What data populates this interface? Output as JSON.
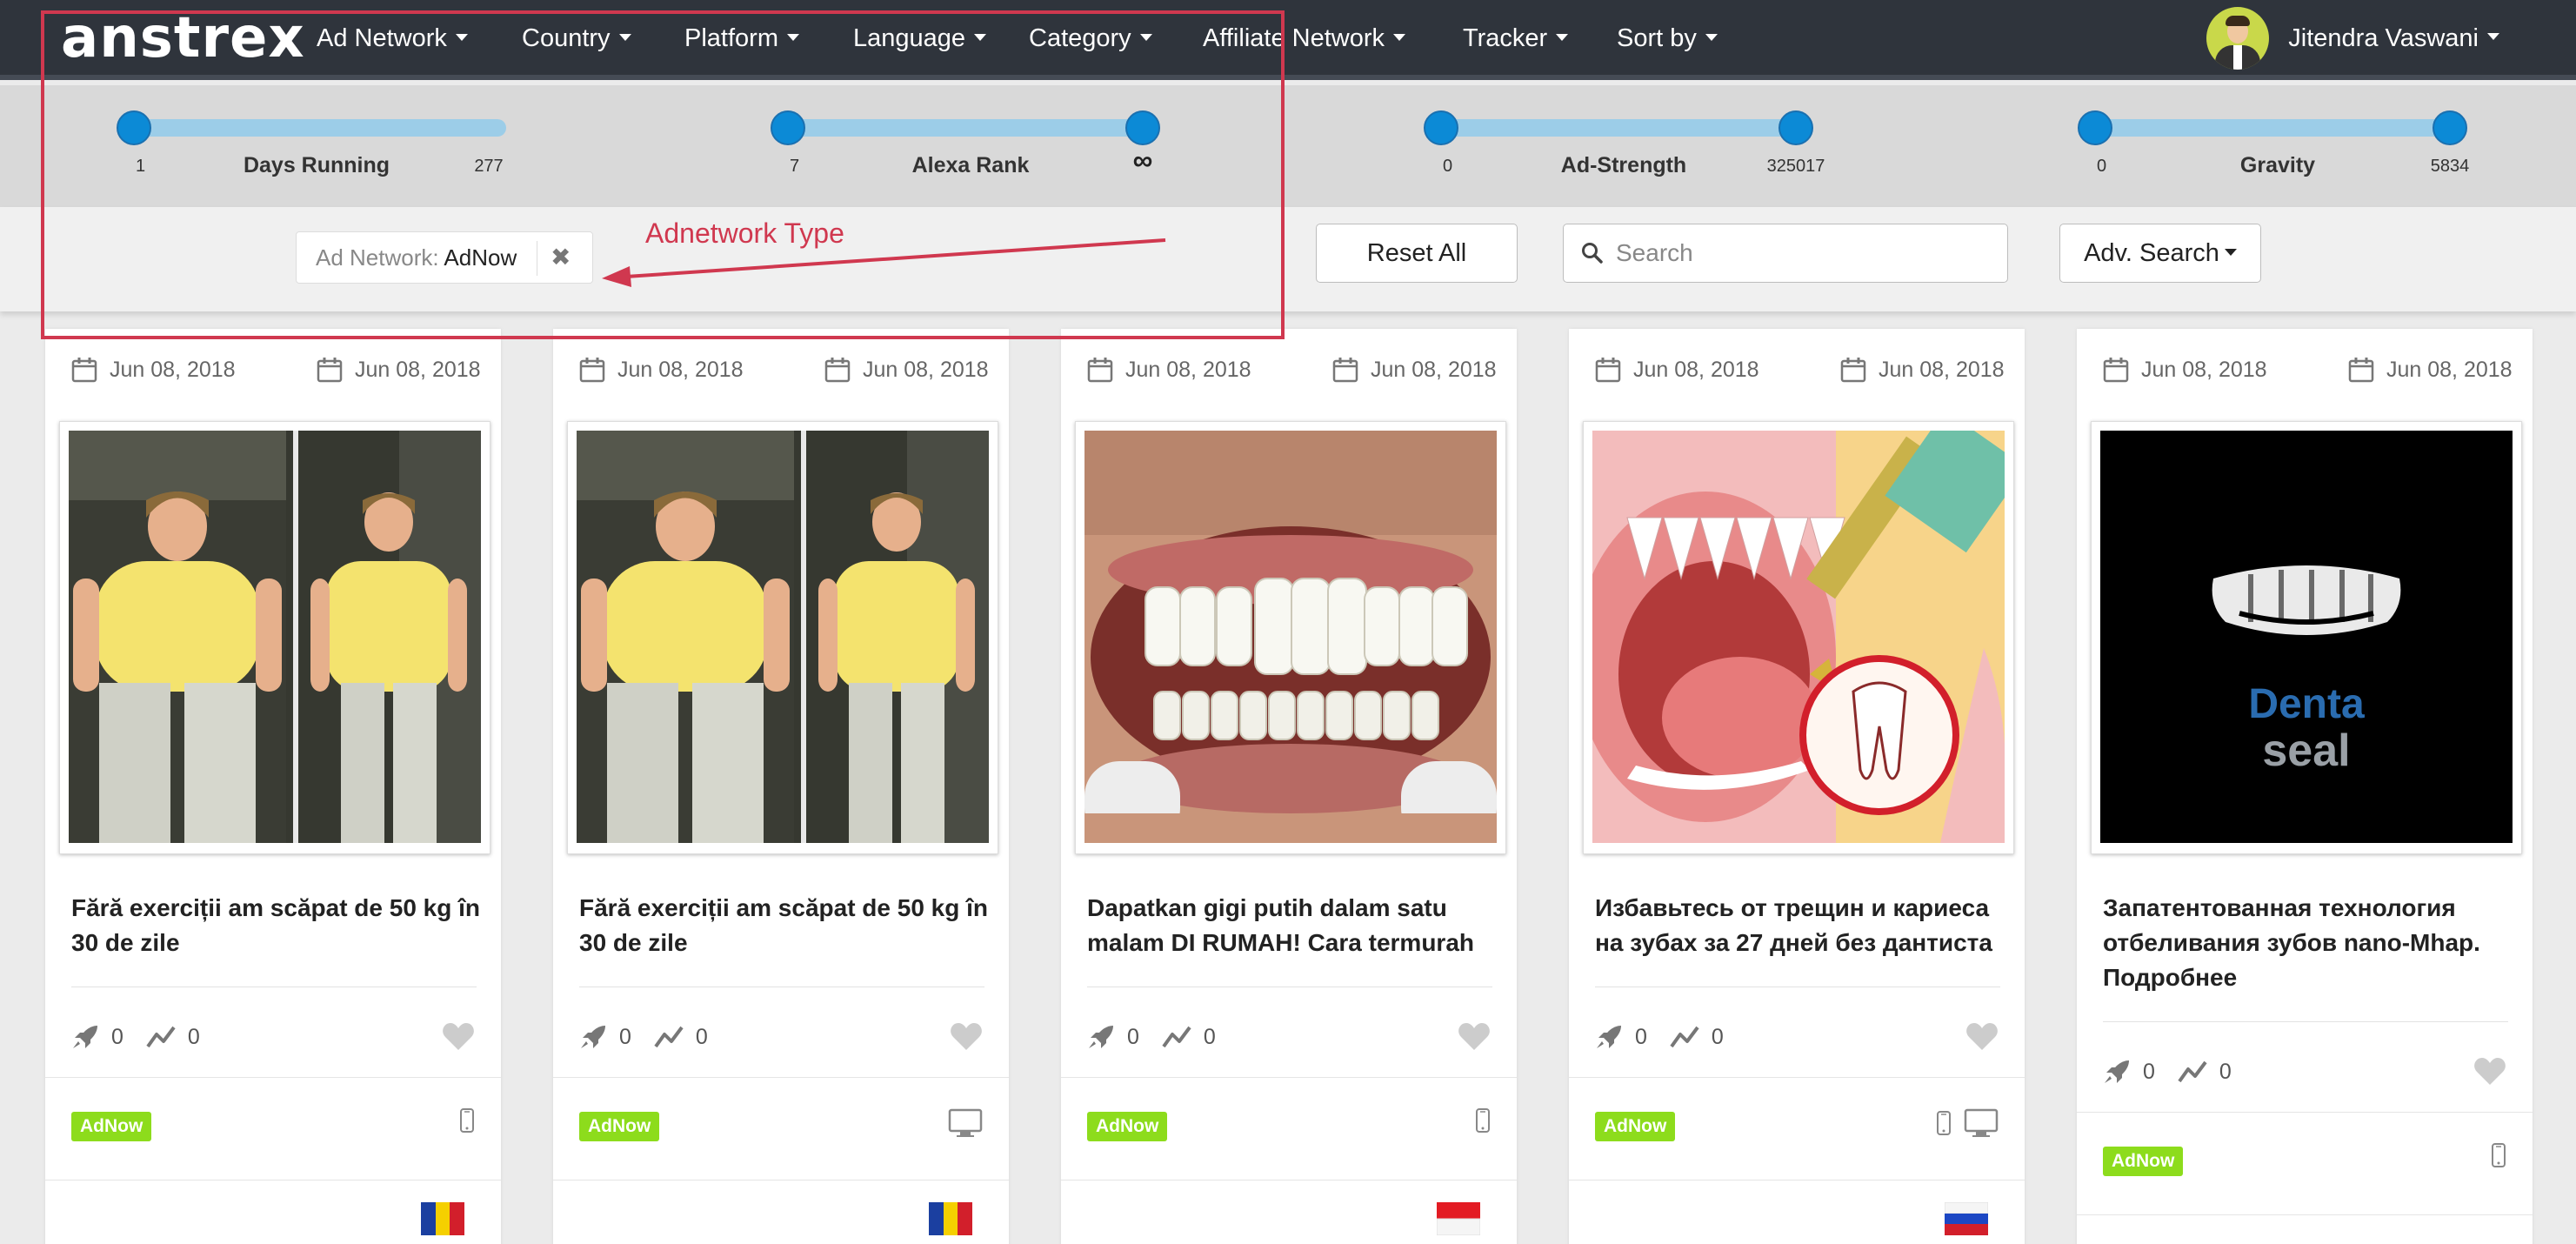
{
  "navbar": {
    "logo": "anstrex",
    "menu": [
      "Ad Network",
      "Country",
      "Platform",
      "Language",
      "Category",
      "Affiliate Network",
      "Tracker",
      "Sort by"
    ],
    "user_name": "Jitendra Vaswani"
  },
  "sliders": [
    {
      "title": "Days Running",
      "min": "1",
      "max": "277",
      "low": 0.0,
      "high": 1.0,
      "two_knobs": false
    },
    {
      "title": "Alexa Rank",
      "min": "7",
      "max": "∞",
      "low": 0.0,
      "high": 1.0,
      "two_knobs": true
    },
    {
      "title": "Ad-Strength",
      "min": "0",
      "max": "325017",
      "low": 0.0,
      "high": 1.0,
      "two_knobs": true
    },
    {
      "title": "Gravity",
      "min": "0",
      "max": "5834",
      "low": 0.0,
      "high": 1.0,
      "two_knobs": true
    }
  ],
  "filters": {
    "active_chip": {
      "key": "Ad Network:",
      "value": "AdNow",
      "remove": "✖"
    },
    "reset_label": "Reset All",
    "search_placeholder": "Search",
    "adv_search_label": "Adv. Search"
  },
  "annotation": {
    "label": "Adnetwork Type",
    "color": "#d0384f"
  },
  "cards": [
    {
      "date_start": "Jun 08, 2018",
      "date_end": "Jun 08, 2018",
      "image": "weight-loss-before-after",
      "title": "Fără exerciții am scăpat de 50 kg în 30 de zile",
      "launches": "0",
      "trend": "0",
      "network": "AdNow",
      "devices": [
        "mobile"
      ],
      "country_flag": "romania"
    },
    {
      "date_start": "Jun 08, 2018",
      "date_end": "Jun 08, 2018",
      "image": "weight-loss-before-after",
      "title": "Fără exerciții am scăpat de 50 kg în 30 de zile",
      "launches": "0",
      "trend": "0",
      "network": "AdNow",
      "devices": [
        "desktop"
      ],
      "country_flag": "romania"
    },
    {
      "date_start": "Jun 08, 2018",
      "date_end": "Jun 08, 2018",
      "image": "teeth-closeup",
      "title": "Dapatkan gigi putih dalam satu malam DI RUMAH! Cara termurah",
      "launches": "0",
      "trend": "0",
      "network": "AdNow",
      "devices": [
        "mobile"
      ],
      "country_flag": "indonesia"
    },
    {
      "date_start": "Jun 08, 2018",
      "date_end": "Jun 08, 2018",
      "image": "tooth-illustration",
      "title": "Избавьтесь от трещин и кариеса на зубах за 27 дней без дантиста",
      "launches": "0",
      "trend": "0",
      "network": "AdNow",
      "devices": [
        "mobile",
        "desktop"
      ],
      "country_flag": "russia"
    },
    {
      "date_start": "Jun 08, 2018",
      "date_end": "Jun 08, 2018",
      "image": "denta-seal-logo",
      "title": "Запатентованная технология отбеливания зубов nano-Mhap. Подробнее",
      "launches": "0",
      "trend": "0",
      "network": "AdNow",
      "devices": [
        "mobile"
      ],
      "country_flag": "partial"
    }
  ],
  "colors": {
    "navbar": "#2f343c",
    "slider_knob": "#0c8ad6",
    "slider_track": "#9ccde8",
    "badge": "#8ddc1c"
  }
}
